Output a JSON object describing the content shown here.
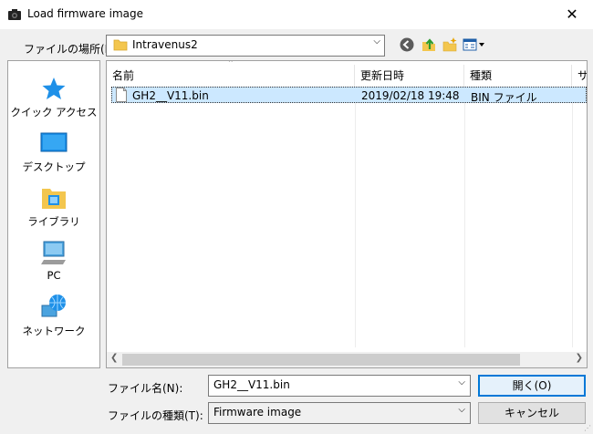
{
  "window": {
    "title": "Load firmware image",
    "close_glyph": "✕",
    "icon": "camera-icon"
  },
  "location": {
    "label": "ファイルの場所(I):",
    "value": "Intravenus2"
  },
  "toolbar": {
    "icons": [
      "back-icon",
      "up-folder-icon",
      "new-folder-icon",
      "view-menu-icon"
    ]
  },
  "sidebar": {
    "items": [
      {
        "label": "クイック アクセス",
        "icon": "star-icon"
      },
      {
        "label": "デスクトップ",
        "icon": "desktop-icon"
      },
      {
        "label": "ライブラリ",
        "icon": "library-icon"
      },
      {
        "label": "PC",
        "icon": "pc-icon"
      },
      {
        "label": "ネットワーク",
        "icon": "network-icon"
      }
    ]
  },
  "filelist": {
    "columns": [
      "名前",
      "更新日時",
      "種類",
      "サ"
    ],
    "rows": [
      {
        "name": "GH2__V11.bin",
        "modified": "2019/02/18 19:48",
        "type": "BIN ファイル"
      }
    ]
  },
  "filename": {
    "label": "ファイル名(N):",
    "value": "GH2__V11.bin"
  },
  "filetype": {
    "label": "ファイルの種類(T):",
    "value": "Firmware image"
  },
  "buttons": {
    "open": "開く(O)",
    "cancel": "キャンセル"
  }
}
